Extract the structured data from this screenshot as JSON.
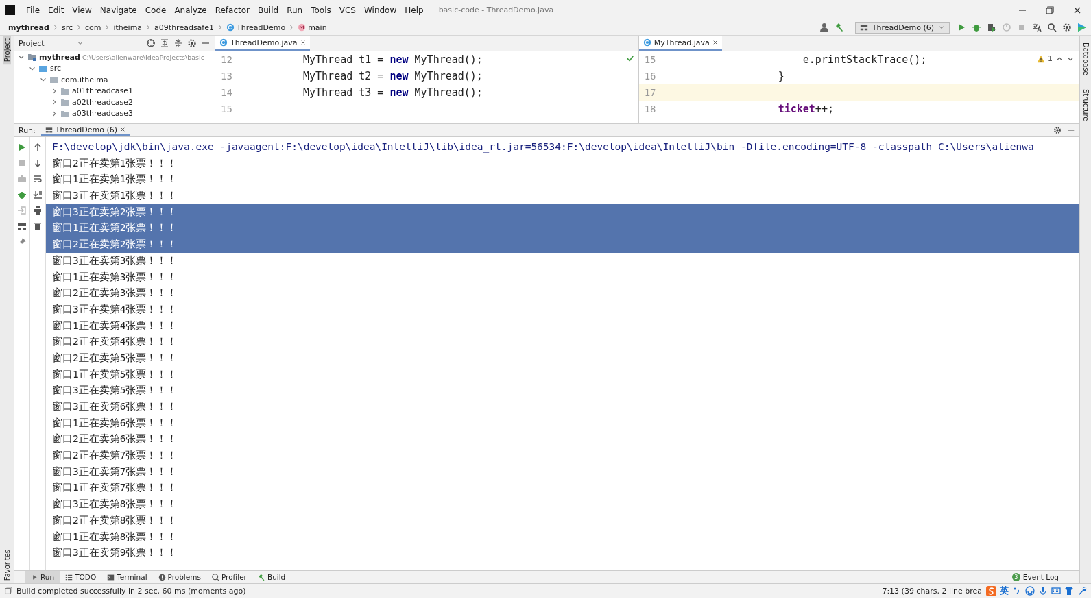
{
  "window": {
    "title": "basic-code - ThreadDemo.java"
  },
  "menu": [
    "File",
    "Edit",
    "View",
    "Navigate",
    "Code",
    "Analyze",
    "Refactor",
    "Build",
    "Run",
    "Tools",
    "VCS",
    "Window",
    "Help"
  ],
  "breadcrumb": [
    {
      "label": "mythread",
      "kind": "project"
    },
    {
      "label": "src",
      "kind": "plain"
    },
    {
      "label": "com",
      "kind": "plain"
    },
    {
      "label": "itheima",
      "kind": "plain"
    },
    {
      "label": "a09threadsafe1",
      "kind": "plain"
    },
    {
      "label": "ThreadDemo",
      "kind": "class"
    },
    {
      "label": "main",
      "kind": "method"
    }
  ],
  "toolbar": {
    "run_config": "ThreadDemo (6)"
  },
  "side_tabs": {
    "left_top": "Project",
    "left_bottom": "Favorites",
    "right": [
      "Database",
      "Structure"
    ]
  },
  "project_pane": {
    "title": "Project",
    "tree": [
      {
        "label": "mythread",
        "path": "C:\\Users\\alienware\\IdeaProjects\\basic-",
        "kind": "module",
        "expanded": true,
        "children": [
          {
            "label": "src",
            "kind": "source",
            "expanded": true,
            "children": [
              {
                "label": "com.itheima",
                "kind": "package",
                "expanded": true,
                "children": [
                  {
                    "label": "a01threadcase1",
                    "kind": "package",
                    "expanded": false
                  },
                  {
                    "label": "a02threadcase2",
                    "kind": "package",
                    "expanded": false
                  },
                  {
                    "label": "a03threadcase3",
                    "kind": "package",
                    "expanded": false
                  }
                ]
              }
            ]
          }
        ]
      }
    ]
  },
  "editors": [
    {
      "tab": "ThreadDemo.java",
      "check": true,
      "lines": [
        {
          "number": "12",
          "current": false,
          "tokens": [
            {
              "text": "MyThread t1 = ",
              "kind": "plain"
            },
            {
              "text": "new",
              "kind": "keyword"
            },
            {
              "text": " MyThread();",
              "kind": "plain"
            }
          ]
        },
        {
          "number": "13",
          "current": false,
          "tokens": [
            {
              "text": "MyThread t2 = ",
              "kind": "plain"
            },
            {
              "text": "new",
              "kind": "keyword"
            },
            {
              "text": " MyThread();",
              "kind": "plain"
            }
          ]
        },
        {
          "number": "14",
          "current": false,
          "tokens": [
            {
              "text": "MyThread t3 = ",
              "kind": "plain"
            },
            {
              "text": "new",
              "kind": "keyword"
            },
            {
              "text": " MyThread();",
              "kind": "plain"
            }
          ]
        },
        {
          "number": "15",
          "current": false
        }
      ]
    },
    {
      "tab": "MyThread.java",
      "warnings": "1",
      "lines": [
        {
          "number": "15",
          "current": false,
          "tokens": [
            {
              "text": "    e.printStackTrace();",
              "kind": "plain"
            }
          ]
        },
        {
          "number": "16",
          "current": false,
          "tokens": [
            {
              "text": "}",
              "kind": "plain"
            }
          ]
        },
        {
          "number": "17",
          "current": true
        },
        {
          "number": "18",
          "current": false,
          "tokens": [
            {
              "text": "ticket",
              "kind": "field"
            },
            {
              "text": "++;",
              "kind": "plain"
            }
          ]
        }
      ]
    }
  ],
  "run_panel": {
    "label": "Run:",
    "tab": "ThreadDemo (6)",
    "command": "F:\\develop\\jdk\\bin\\java.exe -javaagent:F:\\develop\\idea\\IntelliJ\\lib\\idea_rt.jar=56534:F:\\develop\\idea\\IntelliJ\\bin -Dfile.encoding=UTF-8 -classpath ",
    "link": "C:\\Users\\alienwa",
    "output": [
      {
        "text": "窗口2正在卖第1张票！！！",
        "selected": false
      },
      {
        "text": "窗口1正在卖第1张票！！！",
        "selected": false
      },
      {
        "text": "窗口3正在卖第1张票！！！",
        "selected": false
      },
      {
        "text": "窗口3正在卖第2张票！！！",
        "selected": true
      },
      {
        "text": "窗口1正在卖第2张票！！！",
        "selected": true
      },
      {
        "text": "窗口2正在卖第2张票！！！",
        "selected": true
      },
      {
        "text": "窗口3正在卖第3张票！！！",
        "selected": false
      },
      {
        "text": "窗口1正在卖第3张票！！！",
        "selected": false
      },
      {
        "text": "窗口2正在卖第3张票！！！",
        "selected": false
      },
      {
        "text": "窗口3正在卖第4张票！！！",
        "selected": false
      },
      {
        "text": "窗口1正在卖第4张票！！！",
        "selected": false
      },
      {
        "text": "窗口2正在卖第4张票！！！",
        "selected": false
      },
      {
        "text": "窗口2正在卖第5张票！！！",
        "selected": false
      },
      {
        "text": "窗口1正在卖第5张票！！！",
        "selected": false
      },
      {
        "text": "窗口3正在卖第5张票！！！",
        "selected": false
      },
      {
        "text": "窗口3正在卖第6张票！！！",
        "selected": false
      },
      {
        "text": "窗口1正在卖第6张票！！！",
        "selected": false
      },
      {
        "text": "窗口2正在卖第6张票！！！",
        "selected": false
      },
      {
        "text": "窗口2正在卖第7张票！！！",
        "selected": false
      },
      {
        "text": "窗口3正在卖第7张票！！！",
        "selected": false
      },
      {
        "text": "窗口1正在卖第7张票！！！",
        "selected": false
      },
      {
        "text": "窗口3正在卖第8张票！！！",
        "selected": false
      },
      {
        "text": "窗口2正在卖第8张票！！！",
        "selected": false
      },
      {
        "text": "窗口1正在卖第8张票！！！",
        "selected": false
      },
      {
        "text": "窗口3正在卖第9张票！！！",
        "selected": false
      }
    ]
  },
  "bottom_tabs": [
    {
      "label": "Run",
      "kind": "run",
      "selected": true
    },
    {
      "label": "TODO",
      "kind": "todo",
      "selected": false
    },
    {
      "label": "Terminal",
      "kind": "terminal",
      "selected": false
    },
    {
      "label": "Problems",
      "kind": "problems",
      "selected": false
    },
    {
      "label": "Profiler",
      "kind": "profiler",
      "selected": false
    },
    {
      "label": "Build",
      "kind": "build",
      "selected": false
    }
  ],
  "event_log": {
    "count": "3",
    "label": "Event Log"
  },
  "status_bar": {
    "message": "Build completed successfully in 2 sec, 60 ms (moments ago)",
    "position": "7:13 (39 chars, 2 line brea",
    "ime_mode": "英"
  }
}
